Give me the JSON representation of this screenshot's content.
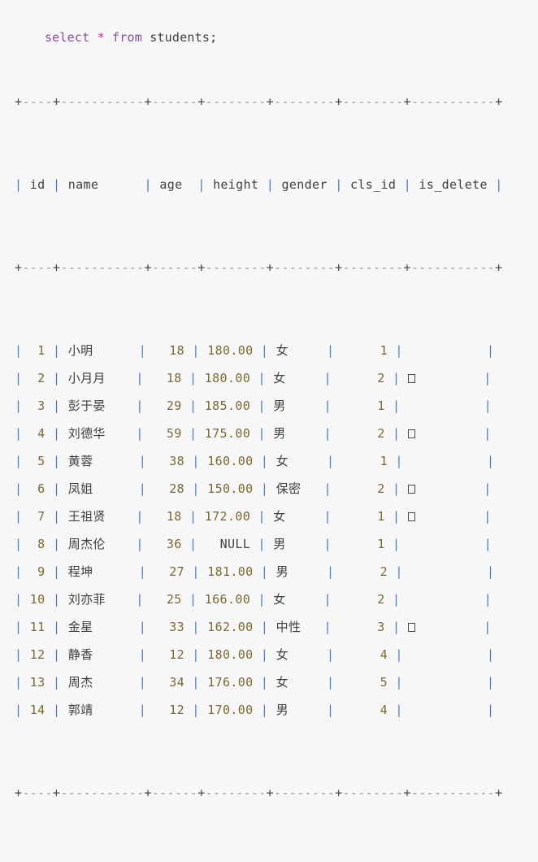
{
  "query": {
    "tokens": [
      {
        "text": "select",
        "kind": "keyword"
      },
      {
        "text": " ",
        "kind": "plain"
      },
      {
        "text": "*",
        "kind": "star"
      },
      {
        "text": " ",
        "kind": "plain"
      },
      {
        "text": "from",
        "kind": "keyword"
      },
      {
        "text": " ",
        "kind": "plain"
      },
      {
        "text": "students",
        "kind": "ident"
      },
      {
        "text": ";",
        "kind": "punc"
      }
    ],
    "raw": "select * from students;",
    "keyword_color": "#8250a8",
    "star_color": "#c2398d",
    "ident_color": "#3c4043"
  },
  "table": {
    "rule": "+----+-----------+------+--------+--------+--------+-----------+",
    "columns": [
      {
        "key": "id",
        "label": "id",
        "width": 2,
        "align": "right"
      },
      {
        "key": "name",
        "label": "name",
        "width": 9,
        "align": "left"
      },
      {
        "key": "age",
        "label": "age",
        "width": 4,
        "align": "right"
      },
      {
        "key": "height",
        "label": "height",
        "width": 6,
        "align": "right"
      },
      {
        "key": "gender",
        "label": "gender",
        "width": 6,
        "align": "left"
      },
      {
        "key": "cls_id",
        "label": "cls_id",
        "width": 6,
        "align": "right"
      },
      {
        "key": "is_delete",
        "label": "is_delete",
        "width": 9,
        "align": "left"
      }
    ],
    "rows": [
      {
        "id": "1",
        "name": "小明",
        "age": "18",
        "height": "180.00",
        "gender": "女",
        "cls_id": "1",
        "is_delete": ""
      },
      {
        "id": "2",
        "name": "小月月",
        "age": "18",
        "height": "180.00",
        "gender": "女",
        "cls_id": "2",
        "is_delete": "\u0001"
      },
      {
        "id": "3",
        "name": "彭于晏",
        "age": "29",
        "height": "185.00",
        "gender": "男",
        "cls_id": "1",
        "is_delete": ""
      },
      {
        "id": "4",
        "name": "刘德华",
        "age": "59",
        "height": "175.00",
        "gender": "男",
        "cls_id": "2",
        "is_delete": "\u0001"
      },
      {
        "id": "5",
        "name": "黄蓉",
        "age": "38",
        "height": "160.00",
        "gender": "女",
        "cls_id": "1",
        "is_delete": ""
      },
      {
        "id": "6",
        "name": "凤姐",
        "age": "28",
        "height": "150.00",
        "gender": "保密",
        "cls_id": "2",
        "is_delete": "\u0001"
      },
      {
        "id": "7",
        "name": "王祖贤",
        "age": "18",
        "height": "172.00",
        "gender": "女",
        "cls_id": "1",
        "is_delete": "\u0001"
      },
      {
        "id": "8",
        "name": "周杰伦",
        "age": "36",
        "height": "NULL",
        "gender": "男",
        "cls_id": "1",
        "is_delete": ""
      },
      {
        "id": "9",
        "name": "程坤",
        "age": "27",
        "height": "181.00",
        "gender": "男",
        "cls_id": "2",
        "is_delete": ""
      },
      {
        "id": "10",
        "name": "刘亦菲",
        "age": "25",
        "height": "166.00",
        "gender": "女",
        "cls_id": "2",
        "is_delete": ""
      },
      {
        "id": "11",
        "name": "金星",
        "age": "33",
        "height": "162.00",
        "gender": "中性",
        "cls_id": "3",
        "is_delete": "\u0001"
      },
      {
        "id": "12",
        "name": "静香",
        "age": "12",
        "height": "180.00",
        "gender": "女",
        "cls_id": "4",
        "is_delete": ""
      },
      {
        "id": "13",
        "name": "周杰",
        "age": "34",
        "height": "176.00",
        "gender": "女",
        "cls_id": "5",
        "is_delete": ""
      },
      {
        "id": "14",
        "name": "郭靖",
        "age": "12",
        "height": "170.00",
        "gender": "男",
        "cls_id": "4",
        "is_delete": ""
      }
    ]
  },
  "theme": {
    "background": "#f7f7f7",
    "pipe_color": "#4d79c7",
    "rule_color": "#9a9a9a",
    "number_color": "#7a6a2e",
    "text_color": "#3c4043"
  }
}
